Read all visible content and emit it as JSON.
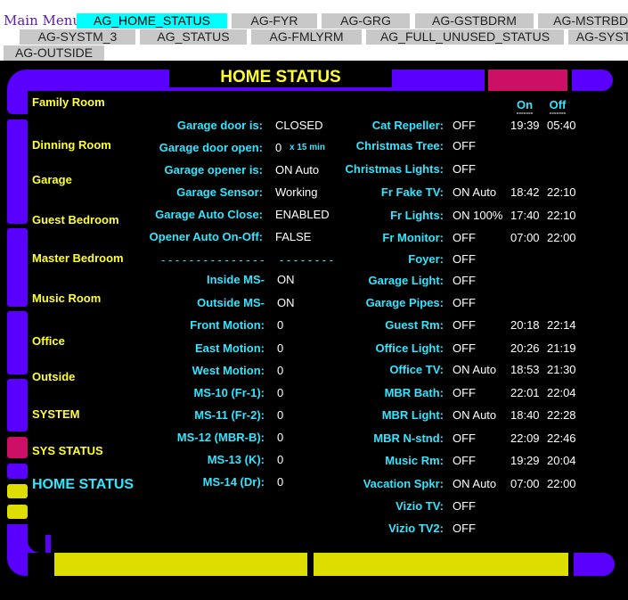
{
  "menu": {
    "main_menu": "Main Menu"
  },
  "tabs_row1": [
    "AG_HOME_STATUS",
    "AG-FYR",
    "AG-GRG",
    "AG-GSTBDRM",
    "AG-MSTRBDRM"
  ],
  "tabs_row2": [
    "AG-SYSTM_3",
    "AG_STATUS",
    "AG-FMLYRM",
    "AG_FULL_UNUSED_STATUS",
    "AG-SYSTEM"
  ],
  "tabs_row3": [
    "AG-OUTSIDE"
  ],
  "title": "HOME  STATUS",
  "nav": [
    "Family Room",
    "Dinning Room",
    "Garage",
    "Guest Bedroom",
    "Master Bedroom",
    "Music Room",
    "Office",
    "Outside",
    "SYSTEM",
    "SYS STATUS",
    "HOME STATUS"
  ],
  "headers": {
    "on": "On",
    "off": "Off",
    "on_dash": "-------",
    "off_dash": "-------"
  },
  "garage": [
    {
      "label": "Garage door is:",
      "value": "CLOSED"
    },
    {
      "label": "Garage door open:",
      "value": "0"
    },
    {
      "label": "Garage opener is:",
      "value": "ON Auto"
    },
    {
      "label": "Garage Sensor:",
      "value": "Working"
    },
    {
      "label": "Garage Auto Close:",
      "value": "ENABLED"
    },
    {
      "label": "Opener Auto On-Off:",
      "value": "FALSE"
    }
  ],
  "door_open_unit": "x 15 min",
  "separator_left": "- - - - - - - - - - - - - - -",
  "separator_right": "- - - - - - - -",
  "motion": [
    {
      "label": "Inside MS-",
      "value": "ON"
    },
    {
      "label": "Outside MS-",
      "value": "ON"
    },
    {
      "label": "Front Motion:",
      "value": "0"
    },
    {
      "label": "East Motion:",
      "value": "0"
    },
    {
      "label": "West Motion:",
      "value": "0"
    },
    {
      "label": "MS-10 (Fr-1):",
      "value": "0"
    },
    {
      "label": "MS-11 (Fr-2):",
      "value": "0"
    },
    {
      "label": "MS-12 (MBR-B):",
      "value": "0"
    },
    {
      "label": "MS-13 (K):",
      "value": "0"
    },
    {
      "label": "MS-14 (Dr):",
      "value": "0"
    }
  ],
  "devices": [
    {
      "label": "Cat Repeller:",
      "value": "OFF",
      "on": "19:39",
      "off": "05:40"
    },
    {
      "label": "Christmas Tree:",
      "value": "OFF",
      "on": "",
      "off": ""
    },
    {
      "label": "Christmas Lights:",
      "value": "OFF",
      "on": "",
      "off": ""
    },
    {
      "label": "Fr Fake TV:",
      "value": "ON Auto",
      "on": "18:42",
      "off": "22:10"
    },
    {
      "label": "Fr Lights:",
      "value": "ON 100%",
      "on": "17:40",
      "off": "22:10"
    },
    {
      "label": "Fr Monitor:",
      "value": "OFF",
      "on": "07:00",
      "off": "22:00"
    },
    {
      "label": "Foyer:",
      "value": "OFF",
      "on": "",
      "off": ""
    },
    {
      "label": "Garage Light:",
      "value": "OFF",
      "on": "",
      "off": ""
    },
    {
      "label": "Garage Pipes:",
      "value": "OFF",
      "on": "",
      "off": ""
    },
    {
      "label": "Guest Rm:",
      "value": "OFF",
      "on": "20:18",
      "off": "22:14"
    },
    {
      "label": "Office Light:",
      "value": "OFF",
      "on": "20:26",
      "off": "21:19"
    },
    {
      "label": "Office TV:",
      "value": "ON Auto",
      "on": "18:53",
      "off": "21:30"
    },
    {
      "label": "MBR Bath:",
      "value": "OFF",
      "on": "22:01",
      "off": "22:04"
    },
    {
      "label": "MBR Light:",
      "value": "ON Auto",
      "on": "18:40",
      "off": "22:28"
    },
    {
      "label": "MBR N-stnd:",
      "value": "OFF",
      "on": "22:09",
      "off": "22:46"
    },
    {
      "label": "Music Rm:",
      "value": "OFF",
      "on": "19:29",
      "off": "20:04"
    },
    {
      "label": "Vacation Spkr:",
      "value": "ON Auto",
      "on": "07:00",
      "off": "22:00"
    },
    {
      "label": "Vizio TV:",
      "value": "OFF",
      "on": "",
      "off": ""
    },
    {
      "label": "Vizio TV2:",
      "value": "OFF",
      "on": "",
      "off": ""
    }
  ],
  "colors": {
    "frame": "#5a00ff",
    "accent_pink": "#cc1066",
    "accent_yellow": "#dddd00",
    "label_cyan": "#33e5ff",
    "nav_yellow": "#ffff33",
    "active_tab": "#00ffff"
  }
}
